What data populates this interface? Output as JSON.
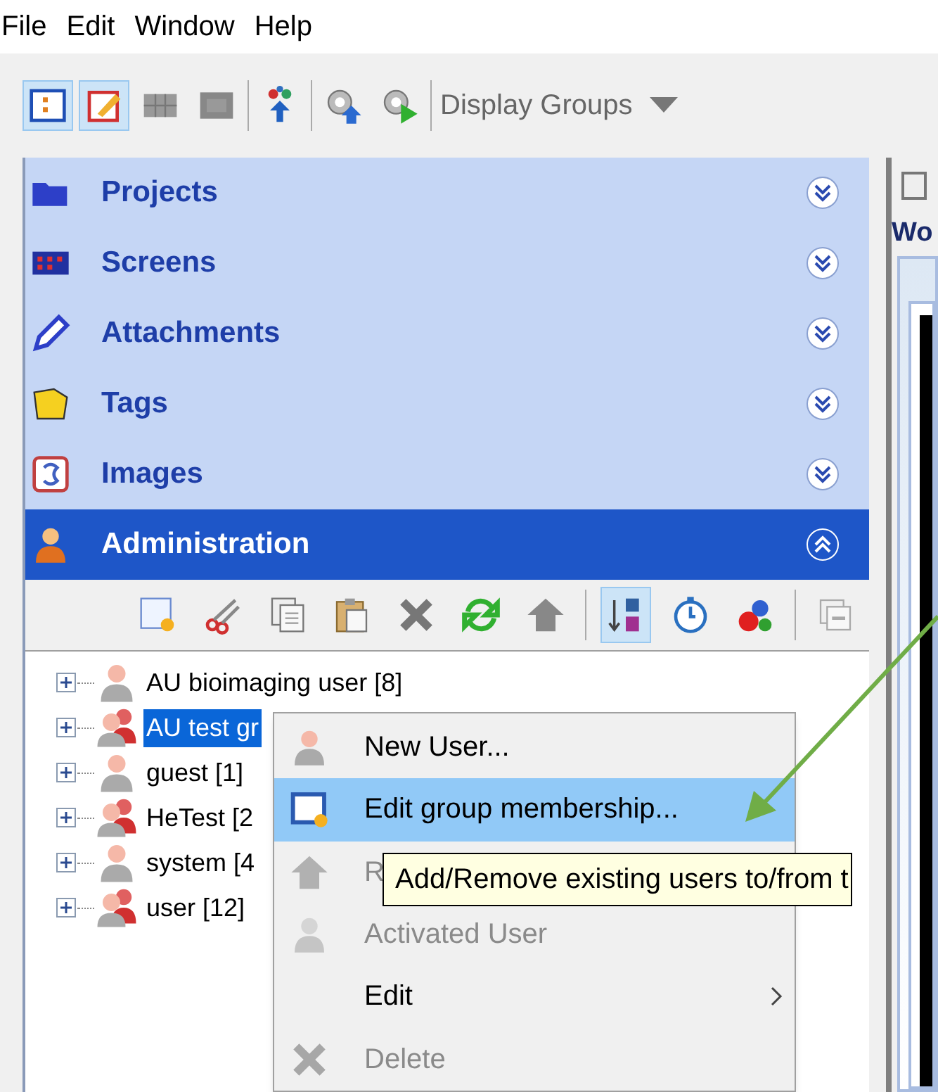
{
  "menu_bar": [
    "File",
    "Edit",
    "Window",
    "Help"
  ],
  "toolbar": {
    "buttons": [
      {
        "selected": true
      },
      {
        "selected": true
      },
      {
        "selected": false
      },
      {
        "selected": false
      },
      {
        "selected": false
      },
      {
        "selected": false
      },
      {
        "selected": false
      }
    ],
    "dropdown": "Display Groups"
  },
  "sections": [
    {
      "label": "Projects",
      "selected": false
    },
    {
      "label": "Screens",
      "selected": false
    },
    {
      "label": "Attachments",
      "selected": false
    },
    {
      "label": "Tags",
      "selected": false
    },
    {
      "label": "Images",
      "selected": false
    },
    {
      "label": "Administration",
      "selected": true
    }
  ],
  "admin_toolbar": [
    {
      "selected": false
    },
    {
      "selected": false
    },
    {
      "selected": false
    },
    {
      "selected": false
    },
    {
      "selected": false
    },
    {
      "selected": false
    },
    {
      "selected": false
    },
    {
      "selected": true
    },
    {
      "selected": false
    },
    {
      "selected": false
    },
    {
      "selected": false
    }
  ],
  "tree": [
    {
      "label": "AU bioimaging user [8]",
      "kind": "user",
      "selected": false
    },
    {
      "label": "AU test gr",
      "kind": "group",
      "selected": true
    },
    {
      "label": "guest [1]",
      "kind": "user",
      "selected": false
    },
    {
      "label": "HeTest [2",
      "kind": "group",
      "selected": false
    },
    {
      "label": "system [4",
      "kind": "user",
      "selected": false
    },
    {
      "label": "user [12]",
      "kind": "group",
      "selected": false
    }
  ],
  "context_menu": [
    {
      "label": "New User...",
      "disabled": false,
      "selected": false,
      "submenu": false
    },
    {
      "label": "Edit group membership...",
      "disabled": false,
      "selected": true,
      "submenu": false
    },
    {
      "label": "R",
      "disabled": true,
      "selected": false,
      "submenu": false
    },
    {
      "label": "Activated User",
      "disabled": true,
      "selected": false,
      "submenu": false
    },
    {
      "label": "Edit",
      "disabled": false,
      "selected": false,
      "submenu": true
    },
    {
      "label": "Delete",
      "disabled": true,
      "selected": false,
      "submenu": false
    }
  ],
  "tooltip": "Add/Remove existing users to/from t",
  "right_panel": {
    "title": "Wo"
  }
}
